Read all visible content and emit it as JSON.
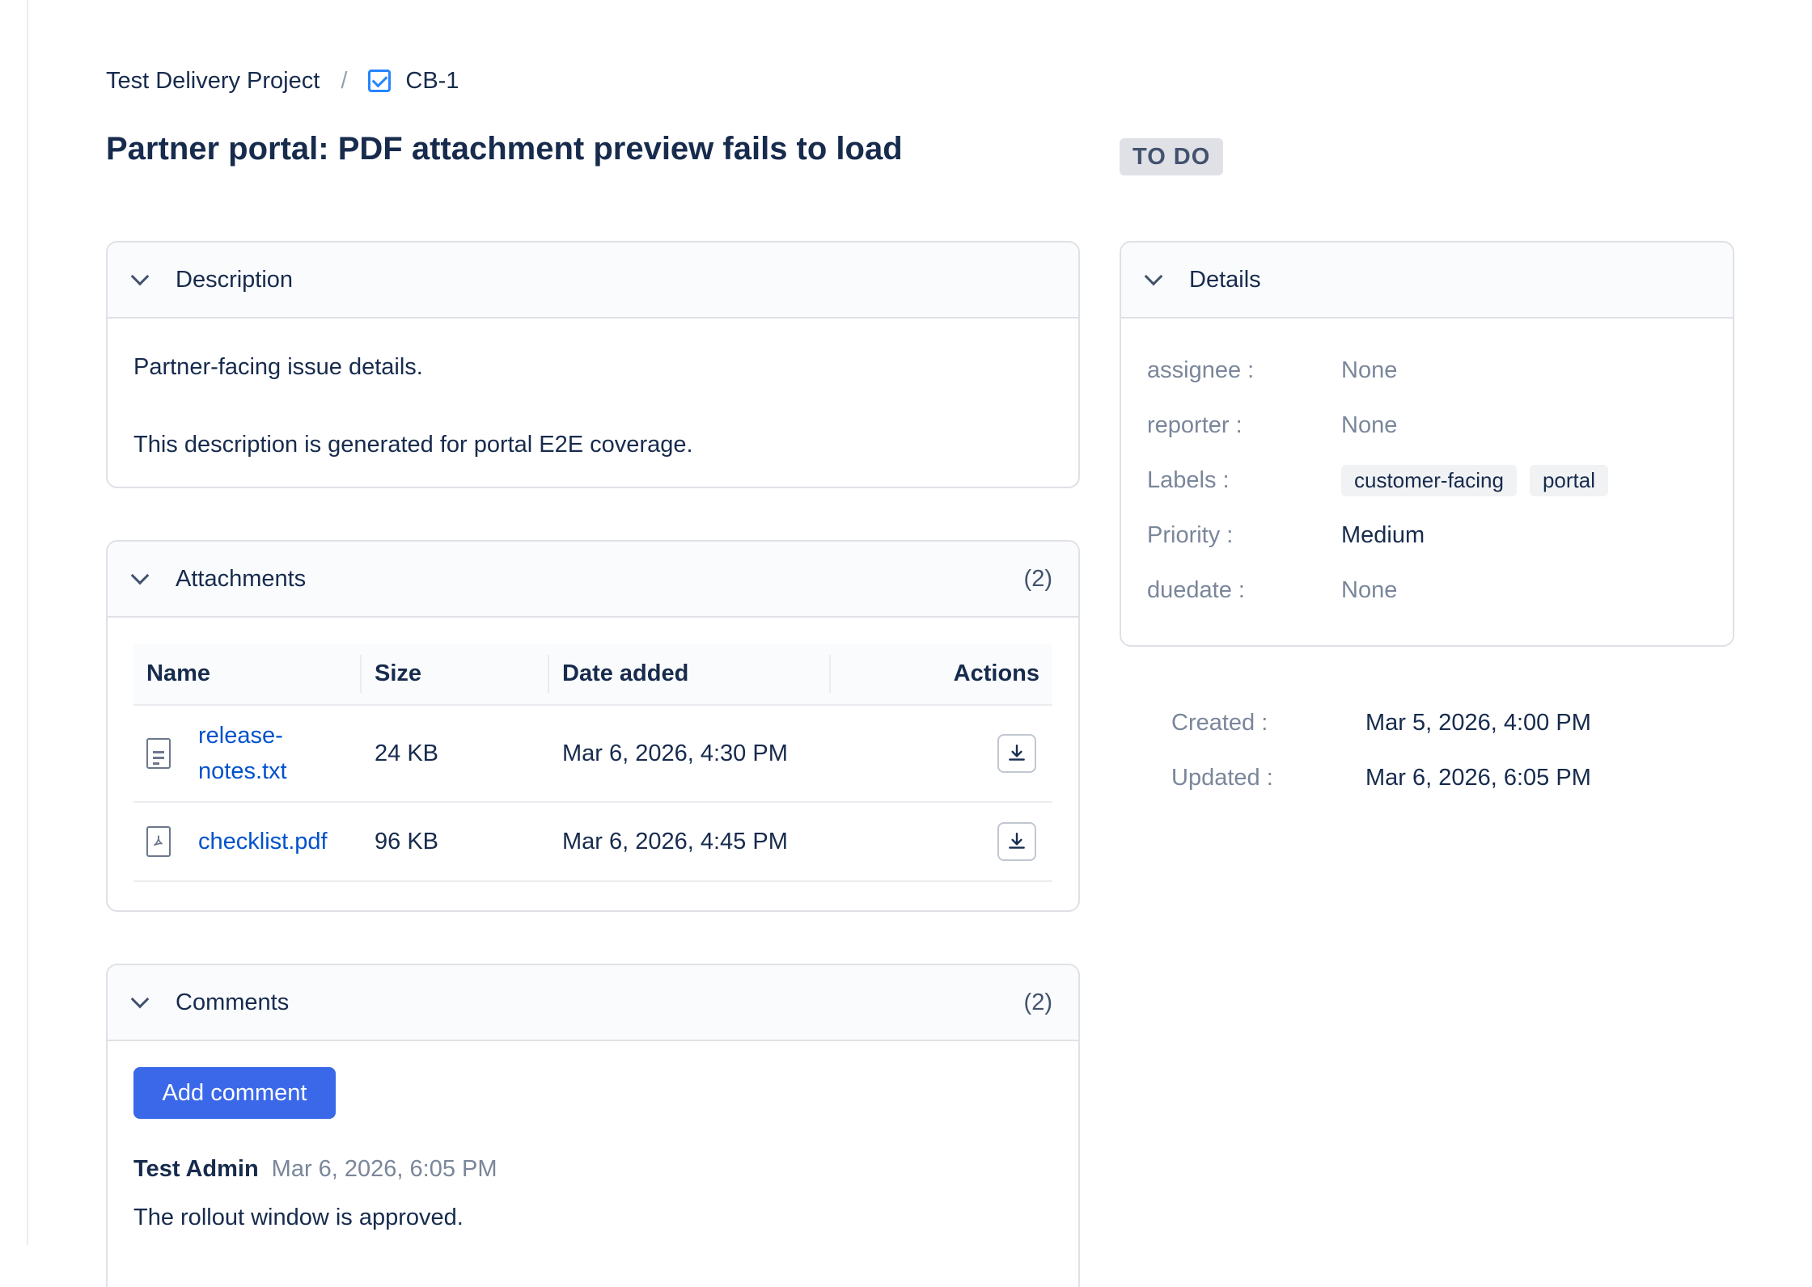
{
  "breadcrumb": {
    "project": "Test Delivery Project",
    "separator": "/",
    "issue_key": "CB-1",
    "issue_icon": "checkbox-icon"
  },
  "issue": {
    "title": "Partner portal: PDF attachment preview fails to load",
    "status": "TO DO"
  },
  "description": {
    "heading": "Description",
    "paragraphs": [
      "Partner-facing issue details.",
      "This description is generated for portal E2E coverage."
    ]
  },
  "attachments": {
    "heading": "Attachments",
    "count": "(2)",
    "columns": [
      "Name",
      "Size",
      "Date added",
      "Actions"
    ],
    "rows": [
      {
        "name_line1": "release-",
        "name_line2": "notes.txt",
        "size": "24 KB",
        "date": "Mar 6, 2026, 4:30 PM",
        "icon": "text-file-icon"
      },
      {
        "name": "checklist.pdf",
        "size": "96 KB",
        "date": "Mar 6, 2026, 4:45 PM",
        "icon": "pdf-file-icon"
      }
    ]
  },
  "comments": {
    "heading": "Comments",
    "count": "(2)",
    "add_label": "Add comment",
    "items": [
      {
        "author": "Test Admin",
        "time": "Mar 6, 2026, 6:05 PM",
        "text": "The rollout window is approved."
      }
    ]
  },
  "details": {
    "heading": "Details",
    "fields": [
      {
        "key": "assignee",
        "value": "None"
      },
      {
        "key": "reporter",
        "value": "None"
      },
      {
        "key": "Labels",
        "labels": [
          "customer-facing",
          "portal"
        ]
      },
      {
        "key": "Priority",
        "value": "Medium"
      },
      {
        "key": "duedate",
        "value": "None"
      }
    ]
  },
  "meta": {
    "created_label": "Created",
    "created": "Mar 5, 2026, 4:00 PM",
    "updated_label": "Updated",
    "updated": "Mar 6, 2026, 6:05 PM"
  },
  "colors": {
    "primary_button": "#3a68e8",
    "link": "#0052cc",
    "status_bg": "#dfe1e6"
  }
}
